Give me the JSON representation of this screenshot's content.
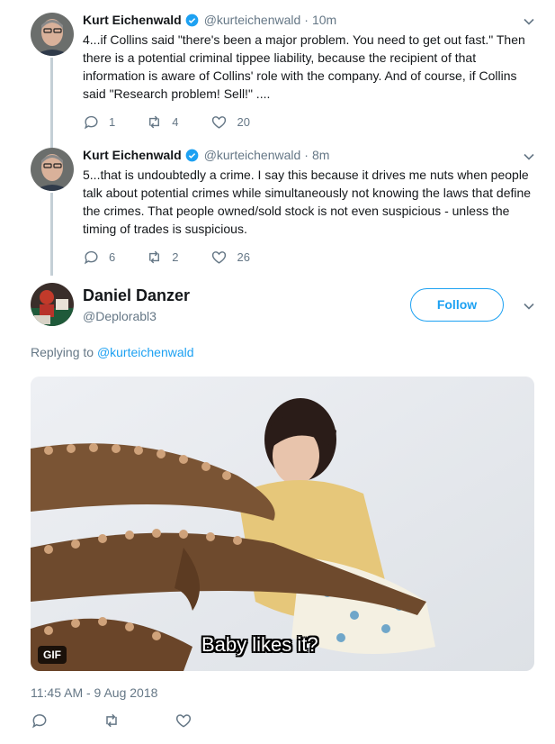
{
  "tweets": [
    {
      "name": "Kurt Eichenwald",
      "handle": "@kurteichenwald",
      "time": "10m",
      "text": "4...if Collins said \"there's been a major problem. You need to get out fast.\" Then\nthere is a potential criminal tippee liability, because the recipient of that\ninformation is aware of Collins' role with the company. And of course, if Collins\nsaid \"Research problem! Sell!\" ....",
      "replies": "1",
      "retweets": "4",
      "likes": "20"
    },
    {
      "name": "Kurt Eichenwald",
      "handle": "@kurteichenwald",
      "time": "8m",
      "text": "5...that is undoubtedly a crime. I say this because it drives me nuts when people\ntalk about potential crimes while simultaneously not knowing the laws that define\nthe crimes. That people owned/sold stock is not even suspicious - unless the\ntiming  of trades is suspicious.",
      "replies": "6",
      "retweets": "2",
      "likes": "26"
    }
  ],
  "main_tweet": {
    "name": "Daniel Danzer",
    "handle": "@Deplorabl3",
    "follow_label": "Follow",
    "replying_prefix": "Replying to",
    "replying_to": "@kurteichenwald",
    "gif_badge": "GIF",
    "gif_subtitle": "Baby likes it?",
    "timestamp": "11:45 AM - 9 Aug 2018"
  },
  "colors": {
    "accent": "#1da1f2",
    "muted": "#657786",
    "thread_line": "#c4cfd6"
  }
}
